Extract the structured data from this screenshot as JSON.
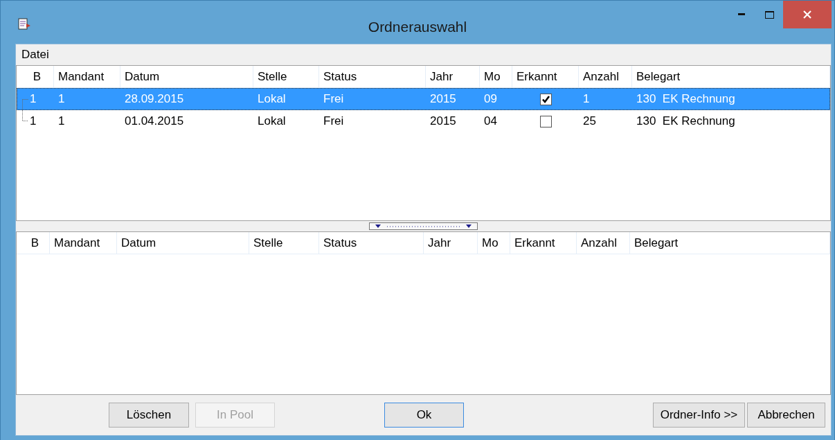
{
  "window": {
    "title": "Ordnerauswahl"
  },
  "menu": [
    {
      "label": "Datei"
    }
  ],
  "top_table": {
    "columns": [
      "B",
      "Mandant",
      "Datum",
      "Stelle",
      "Status",
      "Jahr",
      "Mo",
      "Erkannt",
      "Anzahl",
      "Belegart"
    ],
    "rows": [
      {
        "selected": true,
        "cells": [
          "1",
          "1",
          "28.09.2015",
          "Lokal",
          "Frei",
          "2015",
          "09",
          {
            "checked": true
          },
          "1",
          "130  EK Rechnung"
        ]
      },
      {
        "selected": false,
        "cells": [
          "1",
          "1",
          "01.04.2015",
          "Lokal",
          "Frei",
          "2015",
          "04",
          {
            "checked": false
          },
          "25",
          "130  EK Rechnung"
        ]
      }
    ]
  },
  "bottom_table": {
    "columns": [
      "B",
      "Mandant",
      "Datum",
      "Stelle",
      "Status",
      "Jahr",
      "Mo",
      "Erkannt",
      "Anzahl",
      "Belegart"
    ]
  },
  "buttons": [
    {
      "label": "Löschen",
      "disabled": false,
      "default": false
    },
    {
      "label": "In Pool",
      "disabled": true,
      "default": false
    },
    {
      "label": "Ok",
      "disabled": false,
      "default": true
    },
    {
      "label": "Ordner-Info >>",
      "disabled": false,
      "default": false
    },
    {
      "label": "Abbrechen",
      "disabled": false,
      "default": false
    }
  ]
}
